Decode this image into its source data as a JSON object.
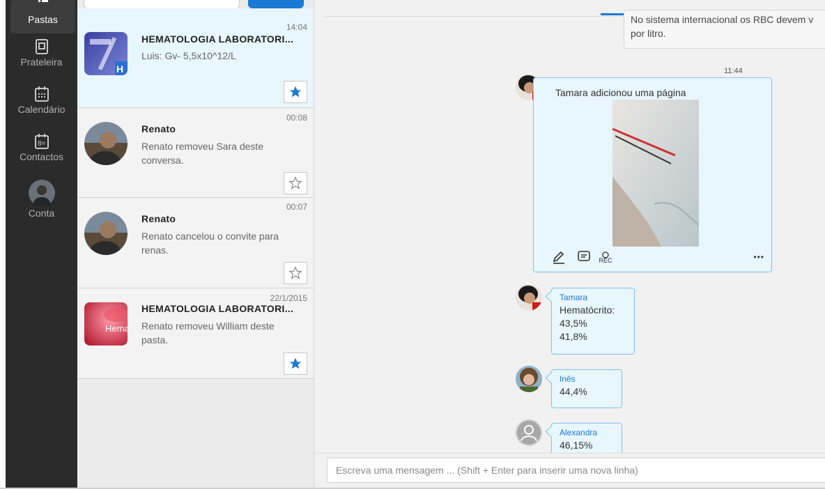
{
  "nav": {
    "items": [
      {
        "label": "Pastas",
        "icon": "folders-icon"
      },
      {
        "label": "Prateleira",
        "icon": "shelf-icon"
      },
      {
        "label": "Calendário",
        "icon": "calendar-icon"
      },
      {
        "label": "Contactos",
        "icon": "contacts-icon"
      },
      {
        "label": "Conta",
        "icon": "account-avatar"
      }
    ]
  },
  "conversations": [
    {
      "time": "14:04",
      "title": "HEMATOLOGIA LABORATORI...",
      "subtitle": "Luis: Gv- 5,5x10^12/L",
      "starred": true
    },
    {
      "time": "00:08",
      "title": "Renato",
      "subtitle": "Renato removeu Sara deste conversa.",
      "starred": false
    },
    {
      "time": "00:07",
      "title": "Renato",
      "subtitle": "Renato cancelou o convite para renas.",
      "starred": false
    },
    {
      "time": "22/1/2015",
      "title": "HEMATOLOGIA LABORATORI...",
      "subtitle": "Renato removeu William deste pasta.",
      "starred": true
    }
  ],
  "chat": {
    "previous_message": "No sistema internacional os RBC devem v\npor litro.",
    "page_card": {
      "time": "11:44",
      "text": "Tamara adicionou uma página",
      "rec_label": "REC",
      "more": "•••"
    },
    "messages": [
      {
        "author": "Tamara",
        "text": "Hematócrito:\n43,5%\n41,8%"
      },
      {
        "author": "Inês",
        "text": "44,4%"
      },
      {
        "author": "Alexandra",
        "text": "46,15%"
      }
    ]
  },
  "composer": {
    "placeholder": "Escreva uma mensagem ... (Shift + Enter para inserir uma nova linha)"
  },
  "colors": {
    "accent": "#1a7ad4",
    "nav_bg": "#2b2b2b",
    "bubble_bg": "#e8f6fd",
    "bubble_border": "#7ec2ec"
  }
}
